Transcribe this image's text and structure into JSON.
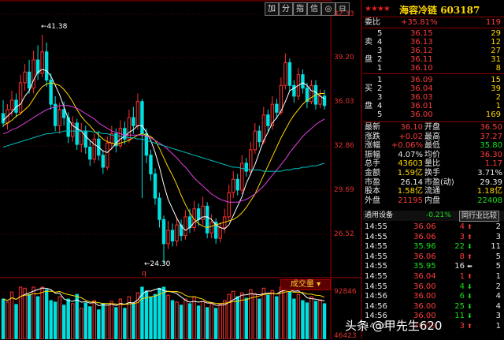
{
  "toolbar": {
    "buttons": [
      "加",
      "分",
      "指",
      "信",
      "◎",
      "⊟"
    ]
  },
  "price_axis": [
    "42.33",
    "39.20",
    "36.03",
    "32.86",
    "29.69",
    "26.52"
  ],
  "vol_axis": [
    "92846",
    "46423"
  ],
  "chart_annotations": {
    "high": "41.38",
    "low": "24.30",
    "low_marker": "q"
  },
  "volume_label": "成交量",
  "stock": {
    "stars": "★★★★",
    "name": "海容冷链",
    "code": "603187"
  },
  "weibi": {
    "label": "委比",
    "pct": "+35.81%",
    "diff": "119"
  },
  "sell": [
    {
      "side": "",
      "n": "5",
      "price": "36.15",
      "vol": "29"
    },
    {
      "side": "卖",
      "n": "4",
      "price": "36.13",
      "vol": "12"
    },
    {
      "side": "",
      "n": "3",
      "price": "36.12",
      "vol": "27"
    },
    {
      "side": "盘",
      "n": "2",
      "price": "36.11",
      "vol": "31"
    },
    {
      "side": "",
      "n": "1",
      "price": "36.10",
      "vol": "8"
    }
  ],
  "buy": [
    {
      "side": "",
      "n": "1",
      "price": "36.09",
      "vol": "15"
    },
    {
      "side": "买",
      "n": "2",
      "price": "36.04",
      "vol": "39"
    },
    {
      "side": "",
      "n": "3",
      "price": "36.03",
      "vol": "2"
    },
    {
      "side": "盘",
      "n": "4",
      "price": "36.01",
      "vol": "1"
    },
    {
      "side": "",
      "n": "5",
      "price": "36.00",
      "vol": "169"
    }
  ],
  "stats": [
    {
      "l1": "最新",
      "v1": "36.10",
      "c1": "red",
      "l2": "开盘",
      "v2": "36.50",
      "c2": "red"
    },
    {
      "l1": "涨跌",
      "v1": "+0.02",
      "c1": "red",
      "l2": "最高",
      "v2": "37.27",
      "c2": "red"
    },
    {
      "l1": "涨幅",
      "v1": "+0.06%",
      "c1": "red",
      "l2": "最低",
      "v2": "35.80",
      "c2": "green"
    },
    {
      "l1": "振幅",
      "v1": "4.07%",
      "c1": "white",
      "l2": "均价",
      "v2": "36.30",
      "c2": "red"
    },
    {
      "l1": "总手",
      "v1": "43603",
      "c1": "yellow",
      "l2": "量比",
      "v2": "1.17",
      "c2": "red"
    },
    {
      "l1": "金额",
      "v1": "1.59亿",
      "c1": "yellow",
      "l2": "换手",
      "v2": "3.71%",
      "c2": "white"
    },
    {
      "l1": "市盈",
      "v1": "26.14",
      "c1": "white",
      "l2": "市盈(动)",
      "v2": "29.39",
      "c2": "white"
    },
    {
      "l1": "股本",
      "v1": "1.58亿",
      "c1": "yellow",
      "l2": "流通",
      "v2": "1.18亿",
      "c2": "yellow"
    },
    {
      "l1": "外盘",
      "v1": "21195",
      "c1": "red",
      "l2": "内盘",
      "v2": "22408",
      "c2": "green"
    }
  ],
  "tabs": {
    "industry": "通用设备",
    "industry_pct": "-0.21%",
    "compare_btn": "同行业比较"
  },
  "ticks": [
    {
      "t": "14:55",
      "p": "36.06",
      "pc": "red",
      "v": "4",
      "dir": "up",
      "n": "2"
    },
    {
      "t": "14:55",
      "p": "36.06",
      "pc": "red",
      "v": "3",
      "dir": "up",
      "n": "3"
    },
    {
      "t": "14:55",
      "p": "35.96",
      "pc": "green",
      "v": "22",
      "dir": "down",
      "n": "11"
    },
    {
      "t": "14:55",
      "p": "36.06",
      "pc": "red",
      "v": "8",
      "dir": "up",
      "n": "5"
    },
    {
      "t": "14:55",
      "p": "35.95",
      "pc": "green",
      "v": "16",
      "dir": "left",
      "n": "5"
    },
    {
      "t": "14:55",
      "p": "36.04",
      "pc": "red",
      "v": "1",
      "dir": "up",
      "n": "1"
    },
    {
      "t": "14:55",
      "p": "36.00",
      "pc": "red",
      "v": "4",
      "dir": "down",
      "n": "2"
    },
    {
      "t": "14:56",
      "p": "36.00",
      "pc": "red",
      "v": "6",
      "dir": "down",
      "n": "4"
    },
    {
      "t": "14:56",
      "p": "36.00",
      "pc": "red",
      "v": "25",
      "dir": "down",
      "n": "4"
    },
    {
      "t": "14:56",
      "p": "36.00",
      "pc": "red",
      "v": "11",
      "dir": "down",
      "n": "3"
    },
    {
      "t": "14:56",
      "p": "36.09",
      "pc": "red",
      "v": "3",
      "dir": "up",
      "n": "1"
    }
  ],
  "watermark": "头条 @甲先生620",
  "chart_data": {
    "type": "candlestick",
    "ylim": [
      23.5,
      43.5
    ],
    "candles": [
      [
        35.5,
        34.8,
        36.5,
        34.5
      ],
      [
        34.8,
        35.8,
        36.2,
        34.3
      ],
      [
        35.8,
        36.5,
        37.2,
        35.3
      ],
      [
        36.5,
        35.6,
        37.0,
        35.2
      ],
      [
        35.6,
        37.8,
        38.4,
        35.4
      ],
      [
        37.8,
        38.6,
        39.2,
        37.2
      ],
      [
        38.6,
        37.4,
        39.5,
        37.0
      ],
      [
        37.4,
        39.5,
        40.2,
        37.0
      ],
      [
        39.5,
        38.5,
        40.6,
        38.0
      ],
      [
        38.5,
        40.1,
        41.38,
        38.2
      ],
      [
        40.1,
        38.0,
        40.8,
        37.5
      ],
      [
        38.0,
        36.2,
        38.5,
        35.8
      ],
      [
        36.2,
        34.6,
        36.8,
        34.2
      ],
      [
        34.6,
        35.8,
        36.3,
        34.0
      ],
      [
        35.8,
        35.2,
        36.4,
        34.6
      ],
      [
        35.2,
        33.8,
        35.6,
        33.3
      ],
      [
        33.8,
        34.8,
        35.3,
        33.4
      ],
      [
        34.8,
        33.2,
        35.1,
        32.8
      ],
      [
        33.2,
        34.2,
        34.8,
        32.6
      ],
      [
        34.2,
        33.0,
        34.6,
        32.5
      ],
      [
        33.0,
        32.1,
        33.5,
        31.6
      ],
      [
        32.1,
        33.6,
        34.0,
        31.8
      ],
      [
        33.6,
        32.4,
        34.2,
        32.0
      ],
      [
        32.4,
        31.5,
        32.8,
        31.0
      ],
      [
        31.5,
        33.3,
        33.8,
        31.3
      ],
      [
        33.3,
        34.0,
        34.6,
        32.8
      ],
      [
        34.0,
        33.1,
        34.4,
        32.6
      ],
      [
        33.1,
        34.4,
        35.0,
        32.9
      ],
      [
        34.4,
        33.6,
        34.9,
        33.2
      ],
      [
        33.6,
        35.2,
        35.8,
        33.3
      ],
      [
        35.2,
        34.6,
        36.0,
        34.0
      ],
      [
        34.6,
        36.4,
        37.0,
        34.3
      ],
      [
        36.4,
        34.0,
        36.6,
        29.2
      ],
      [
        34.0,
        32.4,
        34.4,
        31.8
      ],
      [
        32.4,
        31.0,
        32.8,
        30.5
      ],
      [
        31.0,
        29.2,
        31.4,
        28.7
      ],
      [
        29.2,
        27.6,
        29.6,
        27.0
      ],
      [
        27.6,
        25.8,
        27.9,
        24.3
      ],
      [
        25.8,
        26.8,
        27.5,
        25.4
      ],
      [
        26.8,
        26.0,
        27.3,
        25.6
      ],
      [
        26.0,
        27.2,
        27.8,
        25.6
      ],
      [
        27.2,
        26.4,
        27.6,
        26.0
      ],
      [
        26.4,
        27.8,
        28.3,
        26.1
      ],
      [
        27.8,
        27.0,
        28.4,
        26.6
      ],
      [
        27.0,
        28.4,
        29.0,
        26.7
      ],
      [
        28.4,
        27.6,
        28.8,
        27.1
      ],
      [
        27.6,
        28.6,
        29.3,
        27.2
      ],
      [
        28.6,
        26.6,
        28.9,
        26.2
      ],
      [
        26.6,
        27.4,
        28.0,
        26.2
      ],
      [
        27.4,
        26.2,
        27.7,
        25.8
      ],
      [
        26.2,
        27.0,
        27.4,
        25.9
      ],
      [
        27.0,
        27.8,
        28.4,
        26.6
      ],
      [
        27.8,
        29.6,
        30.2,
        27.5
      ],
      [
        29.6,
        30.6,
        31.2,
        29.2
      ],
      [
        30.6,
        29.8,
        31.0,
        29.4
      ],
      [
        29.8,
        31.8,
        32.4,
        29.5
      ],
      [
        31.8,
        31.2,
        32.2,
        30.8
      ],
      [
        31.2,
        32.8,
        33.4,
        30.9
      ],
      [
        32.8,
        34.2,
        34.8,
        32.5
      ],
      [
        34.2,
        33.4,
        34.6,
        33.0
      ],
      [
        33.4,
        35.4,
        36.0,
        33.2
      ],
      [
        35.4,
        34.6,
        35.8,
        34.1
      ],
      [
        34.6,
        36.2,
        36.8,
        34.3
      ],
      [
        36.2,
        35.6,
        36.6,
        35.1
      ],
      [
        35.6,
        37.6,
        38.2,
        35.4
      ],
      [
        37.6,
        39.3,
        40.0,
        37.3
      ],
      [
        39.3,
        37.6,
        39.6,
        37.2
      ],
      [
        37.6,
        36.8,
        38.0,
        36.3
      ],
      [
        36.8,
        38.4,
        38.9,
        36.5
      ],
      [
        38.4,
        37.4,
        38.8,
        37.0
      ],
      [
        37.4,
        36.4,
        37.8,
        35.9
      ],
      [
        36.4,
        37.6,
        38.0,
        36.2
      ],
      [
        37.6,
        36.2,
        38.0,
        35.8
      ],
      [
        36.2,
        36.8,
        37.3,
        35.9
      ],
      [
        36.8,
        36.1,
        37.27,
        35.8
      ]
    ],
    "volumes": [
      52,
      48,
      61,
      45,
      70,
      66,
      58,
      72,
      55,
      80,
      64,
      50,
      48,
      55,
      44,
      52,
      46,
      58,
      40,
      47,
      42,
      50,
      38,
      46,
      44,
      49,
      41,
      52,
      40,
      55,
      47,
      60,
      88,
      62,
      54,
      58,
      66,
      74,
      57,
      50,
      48,
      44,
      52,
      46,
      55,
      43,
      49,
      41,
      46,
      40,
      45,
      50,
      58,
      62,
      55,
      60,
      53,
      64,
      59,
      52,
      66,
      57,
      63,
      55,
      68,
      74,
      61,
      52,
      58,
      50,
      47,
      55,
      49,
      51,
      46
    ],
    "ma5": [
      35.0,
      35.3,
      35.6,
      36.0,
      36.2,
      36.8,
      37.2,
      38.0,
      38.6,
      38.8,
      38.7,
      38.3,
      37.6,
      36.9,
      36.0,
      35.1,
      34.6,
      34.4,
      34.2,
      33.8,
      33.5,
      33.2,
      33.0,
      32.7,
      32.6,
      32.9,
      33.3,
      33.6,
      33.8,
      34.1,
      34.3,
      34.6,
      34.6,
      34.1,
      33.5,
      32.6,
      31.5,
      30.2,
      29.1,
      28.4,
      27.7,
      27.1,
      26.8,
      27.0,
      27.4,
      27.6,
      27.8,
      27.8,
      27.6,
      27.2,
      27.0,
      26.9,
      27.2,
      27.9,
      28.6,
      29.3,
      30.3,
      31.0,
      31.7,
      32.6,
      33.5,
      34.1,
      34.8,
      35.2,
      35.7,
      36.4,
      37.2,
      37.4,
      37.6,
      37.8,
      37.6,
      37.2,
      37.1,
      36.8,
      36.6
    ],
    "ma10": [
      34.6,
      34.8,
      35.0,
      35.3,
      35.5,
      35.8,
      36.1,
      36.6,
      37.1,
      37.5,
      37.7,
      37.8,
      37.7,
      37.6,
      37.3,
      36.9,
      36.4,
      35.8,
      35.3,
      34.9,
      34.6,
      34.2,
      33.9,
      33.6,
      33.4,
      33.3,
      33.2,
      33.3,
      33.4,
      33.5,
      33.7,
      33.9,
      34.0,
      33.9,
      33.8,
      33.5,
      32.9,
      32.2,
      31.5,
      30.9,
      30.2,
      29.4,
      28.7,
      28.1,
      27.6,
      27.3,
      27.1,
      27.0,
      27.1,
      27.2,
      27.3,
      27.4,
      27.5,
      27.6,
      27.8,
      28.1,
      28.5,
      29.0,
      29.5,
      30.2,
      30.9,
      31.6,
      32.3,
      33.0,
      33.7,
      34.3,
      34.9,
      35.4,
      35.8,
      36.2,
      36.5,
      36.7,
      36.9,
      37.0,
      37.0
    ],
    "ma20": [
      34.0,
      34.1,
      34.3,
      34.4,
      34.6,
      34.8,
      35.0,
      35.2,
      35.4,
      35.6,
      35.8,
      35.9,
      36.0,
      36.1,
      36.1,
      36.1,
      36.0,
      35.9,
      35.7,
      35.5,
      35.3,
      35.1,
      34.8,
      34.6,
      34.4,
      34.2,
      34.1,
      34.0,
      33.9,
      33.9,
      33.9,
      33.9,
      33.9,
      33.8,
      33.7,
      33.5,
      33.3,
      33.1,
      32.8,
      32.5,
      32.2,
      31.8,
      31.5,
      31.1,
      30.7,
      30.4,
      30.1,
      29.8,
      29.5,
      29.3,
      29.1,
      29.0,
      28.9,
      28.9,
      28.9,
      29.0,
      29.1,
      29.3,
      29.5,
      29.8,
      30.1,
      30.5,
      30.9,
      31.3,
      31.7,
      32.1,
      32.6,
      33.0,
      33.4,
      33.8,
      34.1,
      34.4,
      34.7,
      34.9,
      35.1
    ],
    "ma60": [
      33.0,
      33.1,
      33.2,
      33.3,
      33.4,
      33.5,
      33.6,
      33.7,
      33.8,
      33.9,
      34.0,
      34.0,
      34.1,
      34.1,
      34.2,
      34.2,
      34.2,
      34.2,
      34.2,
      34.2,
      34.2,
      34.1,
      34.1,
      34.0,
      34.0,
      33.9,
      33.9,
      33.8,
      33.8,
      33.7,
      33.7,
      33.6,
      33.6,
      33.5,
      33.4,
      33.3,
      33.2,
      33.1,
      33.0,
      32.9,
      32.8,
      32.7,
      32.6,
      32.5,
      32.4,
      32.3,
      32.2,
      32.1,
      32.0,
      31.9,
      31.8,
      31.7,
      31.6,
      31.5,
      31.5,
      31.4,
      31.4,
      31.3,
      31.3,
      31.3,
      31.2,
      31.2,
      31.2,
      31.2,
      31.2,
      31.3,
      31.3,
      31.4,
      31.4,
      31.5,
      31.5,
      31.6,
      31.6,
      31.7,
      31.8
    ]
  }
}
